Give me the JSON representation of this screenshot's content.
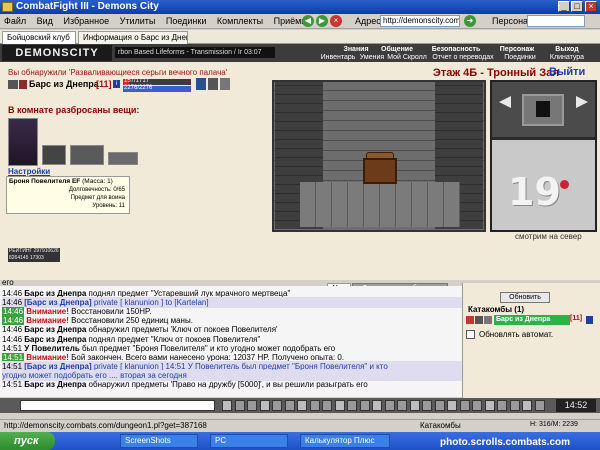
{
  "window": {
    "title": "CombatFight III - Demons City",
    "buttons": [
      "_",
      "□",
      "×"
    ]
  },
  "menu": [
    "Файл",
    "Вид",
    "Избранное",
    "Утилиты",
    "Поединки",
    "Комплекты",
    "Приёмы"
  ],
  "address": {
    "label": "Адрес:",
    "value": "http://demonscity.combat",
    "persona_label": "Персонаж:"
  },
  "browser_tabs": [
    "Бойцовский клуб",
    "Информация о Барс из Днепра"
  ],
  "game": {
    "logo": "DEMONSCITY",
    "marquee": "rbon Based Lifeforms - Transmission / Ir",
    "clock": "03:07",
    "nav_top": [
      "Знания",
      "Общение",
      "Безопасность",
      "Персонаж",
      "Выход"
    ],
    "nav_bottom": [
      "Инвентарь",
      "Умения",
      "Мой Скролл",
      "Отчет о переводах",
      "Поединки",
      "Клинатура"
    ]
  },
  "left": {
    "found_text": "Вы обнаружили 'Разваливающиеся серьги вечного палача'",
    "char_name": "Барс из Днепра",
    "char_level": "[11]",
    "hp": "157/1717",
    "mana": "2276/2276",
    "hp_fraction": 0.09,
    "mana_fraction": 1.0,
    "items_title": "В комнате разбросаны вещи:",
    "settings_link": "Настройки",
    "item_info": {
      "name": "Броня Повелителя EF",
      "mass": "(Масса: 1)",
      "durability": "Долговечность: 0/65",
      "purpose": "Предмет для воина",
      "level": "Уровень: 11"
    },
    "counter": "РЕЙТИНГ 297910626",
    "counter2": "8264145 17303"
  },
  "room": {
    "title": "Этаж 4Б - Тронный Зал",
    "exit": "Выйти",
    "map_number": "19",
    "look_text": "смотрим на север"
  },
  "chat": {
    "tabs": [
      "Чат",
      "Системные сообщения"
    ],
    "lines": [
      {
        "time": "его",
        "text": ""
      },
      {
        "time": "14:46",
        "name": "Барс из Днепра",
        "text": "поднял предмет \"Устаревший лук мрачного мертвеца\"",
        "style": "normal"
      },
      {
        "time": "14:46",
        "name": "[Барс из Днепра]",
        "text": "private [ klanunion ] to [Kartelan]",
        "style": "priv"
      },
      {
        "time": "14:46",
        "name": "Внимание!",
        "text": "Восстановили 150HP.",
        "style": "green"
      },
      {
        "time": "14:46",
        "name": "Внимание!",
        "text": "Восстановили 250 единиц маны.",
        "style": "green"
      },
      {
        "time": "14:46",
        "name": "Барс из Днепра",
        "text": "обнаружил предметы 'Ключ от покоев Повелителя'",
        "style": "normal"
      },
      {
        "time": "14:46",
        "name": "Барс из Днепра",
        "text": "поднял предмет \"Ключ от покоев Повелителя\"",
        "style": "normal"
      },
      {
        "time": "14:51",
        "name": "У Повелитель",
        "text": "был предмет \"Броня Повелителя\" и кто угодно может подобрать его",
        "style": "normal"
      },
      {
        "time": "14:51",
        "name": "Внимание!",
        "text": "Бой закончен. Всего вами нанесено урона: 12037 HP. Получено опыта: 0.",
        "style": "green"
      },
      {
        "time": "14:51",
        "name": "[Барс из Днепра]",
        "text": "private [ klanunion ] 14:51 У Повелитель был предмет \"Броня Повелителя\" и кто",
        "style": "priv"
      },
      {
        "time": "",
        "name": "",
        "text": "угодно может подобрать его .... вторая за сегодня",
        "style": "priv"
      },
      {
        "time": "14:51",
        "name": "Барс из Днепра",
        "text": "обнаружил предметы 'Право на дружбу [5000]', и вы решили разыграть его",
        "style": "normal"
      }
    ]
  },
  "right": {
    "refresh": "Обновить",
    "location": "Катакомбы (1)",
    "player": "Барс из Днепра",
    "player_level": "[11]",
    "auto_label": "Обновлять автомат."
  },
  "status": {
    "url": "http://demonscity.combats.com/dungeon1.pl?get=387168",
    "zone": "Катакомбы",
    "memory": "H: 316/M: 2239",
    "watermark": "photo.scrolls.combats.com"
  },
  "taskbar": {
    "start": "пуск",
    "items": [
      "ScreenShots",
      "PC",
      "Калькулятор Плюс"
    ],
    "clock": "14:52"
  }
}
